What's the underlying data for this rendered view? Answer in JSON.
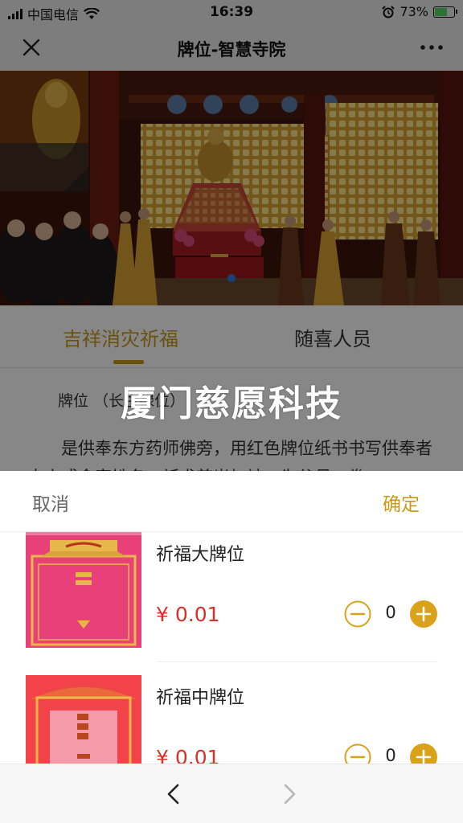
{
  "status_bar": {
    "carrier": "中国电信",
    "time": "16:39",
    "battery_percent": "73%",
    "battery_level": 0.73,
    "icons": [
      "signal-icon",
      "wifi-icon",
      "alarm-icon",
      "battery-icon"
    ]
  },
  "nav": {
    "title": "牌位-智慧寺院",
    "close_icon": "close-icon",
    "more_icon": "more-icon"
  },
  "tabs": [
    {
      "label": "吉祥消灾祈福",
      "active": true
    },
    {
      "label": "随喜人员",
      "active": false
    }
  ],
  "info": {
    "label": "牌位",
    "value": "（长生禄位）"
  },
  "description": "是供奉东方药师佛旁，用红色牌位纸书书写供奉者本人或全家姓名，祈求慈光加被，为父母、眷",
  "watermark": "厦门慈愿科技",
  "sheet": {
    "cancel_label": "取消",
    "confirm_label": "确定",
    "items": [
      {
        "name": "祈福大牌位",
        "price": "¥ 0.01",
        "count": "0"
      },
      {
        "name": "祈福中牌位",
        "price": "¥ 0.01",
        "count": "0"
      }
    ]
  },
  "colors": {
    "accent": "#c99a1a",
    "price": "#d9302a",
    "battery": "#4cd964"
  },
  "toolbar": {
    "back_icon": "chevron-left-icon",
    "forward_icon": "chevron-right-icon"
  }
}
